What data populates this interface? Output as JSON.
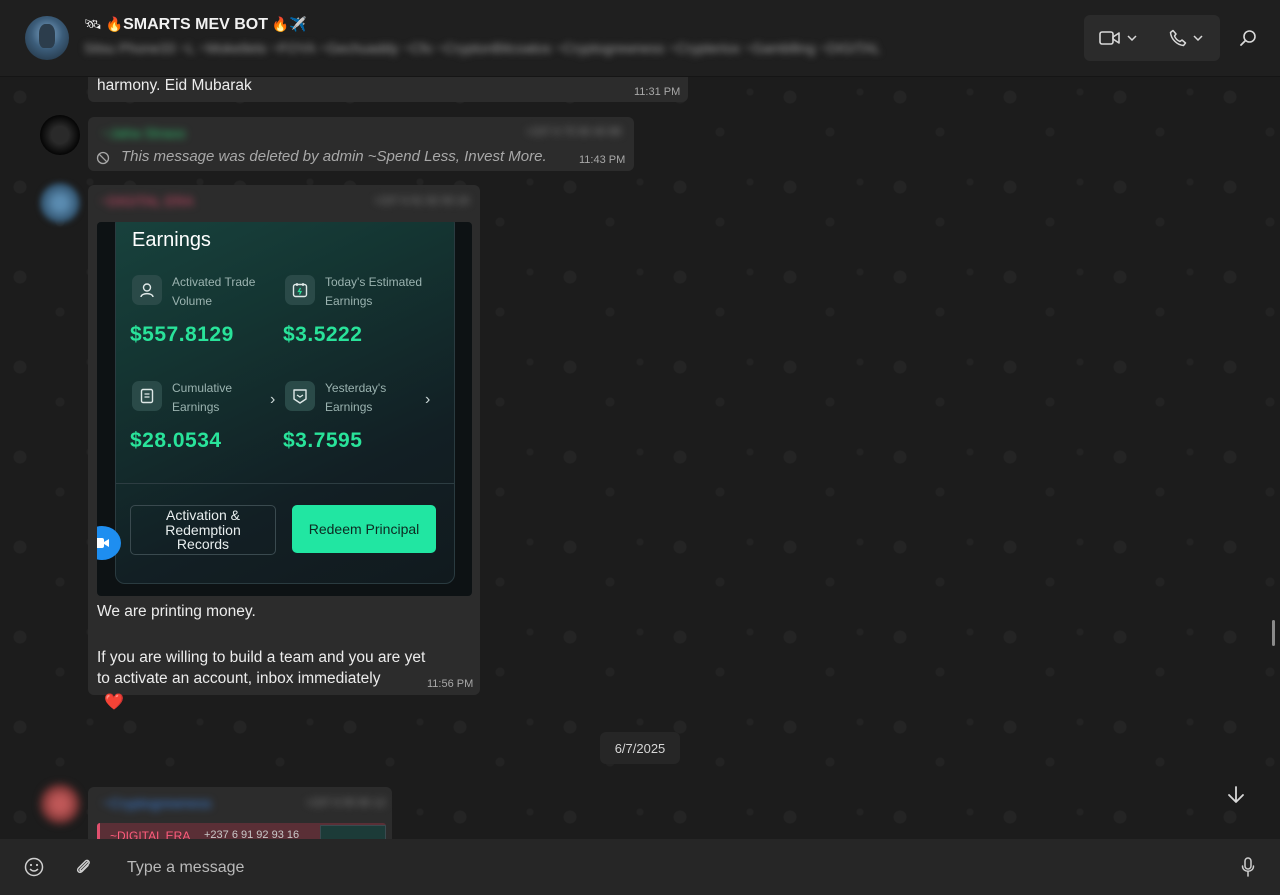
{
  "header": {
    "title_prefix": "🛰 🔥",
    "title_name": "SMARTS MEV BOT",
    "title_suffix": " 🔥✈️",
    "participants": "Sitsu Phone33 ~L ~Moketlets ~FOYA ~Gechuaddy ~Cfo ~CryptonBitcoatos ~Cryptogrewness ~Crypteriox ~Gamblling ~DIGITAL"
  },
  "messages": [
    {
      "text": "harmony. Eid Mubarak",
      "time": "11:31 PM"
    },
    {
      "sender": "~Jaha Straoo",
      "sender_extra": "+237 6 75 90 40 88",
      "deleted_text": "This message was deleted by admin ~Spend Less, Invest More.",
      "time": "11:43 PM"
    },
    {
      "sender": "~DIGITAL ERA",
      "sender_extra": "+237 6 91 92 93 16",
      "image": {
        "title": "Earnings",
        "cells": [
          {
            "label_line1": "Activated Trade",
            "label_line2": "Volume",
            "value": "$557.8129",
            "icon": "user-icon"
          },
          {
            "label_line1": "Today's Estimated",
            "label_line2": "Earnings",
            "value": "$3.5222",
            "icon": "calendar-icon"
          },
          {
            "label_line1": "Cumulative",
            "label_line2": "Earnings",
            "value": "$28.0534",
            "icon": "document-icon"
          },
          {
            "label_line1": "Yesterday's",
            "label_line2": "Earnings",
            "value": "$3.7595",
            "icon": "badge-icon"
          }
        ],
        "button_left_line1": "Activation &",
        "button_left_line2": "Redemption",
        "button_left_line3": "Records",
        "button_right": "Redeem Principal"
      },
      "caption_line1": "We are printing money.",
      "caption_line2": "If you are willing to build a team and you are yet",
      "caption_line3": "to activate an account, inbox immediately",
      "time": "11:56 PM",
      "reaction": "❤️"
    }
  ],
  "date_separator": "6/7/2025",
  "last_message": {
    "sender": "~Cryptogrewness",
    "sender_extra": "+237 6 55 90 12",
    "quote_name": "~DIGITAL ERA",
    "quote_number": "+237 6 91 92 93 16"
  },
  "composer": {
    "placeholder": "Type a message"
  },
  "colors": {
    "accent_green": "#29e39a",
    "redeem_button": "#21e6a2",
    "bubble": "#2c2c2c",
    "background": "#1c1c1c"
  }
}
